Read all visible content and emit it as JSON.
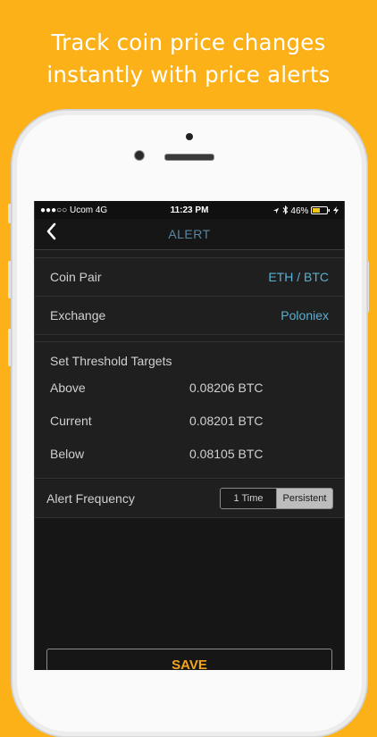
{
  "headline": {
    "line1": "Track coin price changes",
    "line2": "instantly with price alerts"
  },
  "status_bar": {
    "carrier": "●●●○○ Ucom  4G",
    "time": "11:23 PM",
    "battery": "46%",
    "battery_icon": "battery-icon",
    "location_icon": "location-arrow-icon",
    "bluetooth_icon": "bluetooth-icon"
  },
  "nav": {
    "title": "ALERT",
    "back_icon": "chevron-left-icon"
  },
  "settings": {
    "coin_pair_label": "Coin Pair",
    "coin_pair_value": "ETH / BTC",
    "exchange_label": "Exchange",
    "exchange_value": "Poloniex"
  },
  "threshold": {
    "title": "Set Threshold Targets",
    "rows": [
      {
        "label": "Above",
        "value": "0.08206 BTC"
      },
      {
        "label": "Current",
        "value": "0.08201 BTC"
      },
      {
        "label": "Below",
        "value": "0.08105 BTC"
      }
    ]
  },
  "frequency": {
    "label": "Alert Frequency",
    "options": [
      "1 Time",
      "Persistent"
    ],
    "selected": "Persistent"
  },
  "save_label": "SAVE",
  "colors": {
    "background": "#fbb117",
    "accent_blue": "#5ab0d0",
    "save_text": "#f3a51a"
  }
}
